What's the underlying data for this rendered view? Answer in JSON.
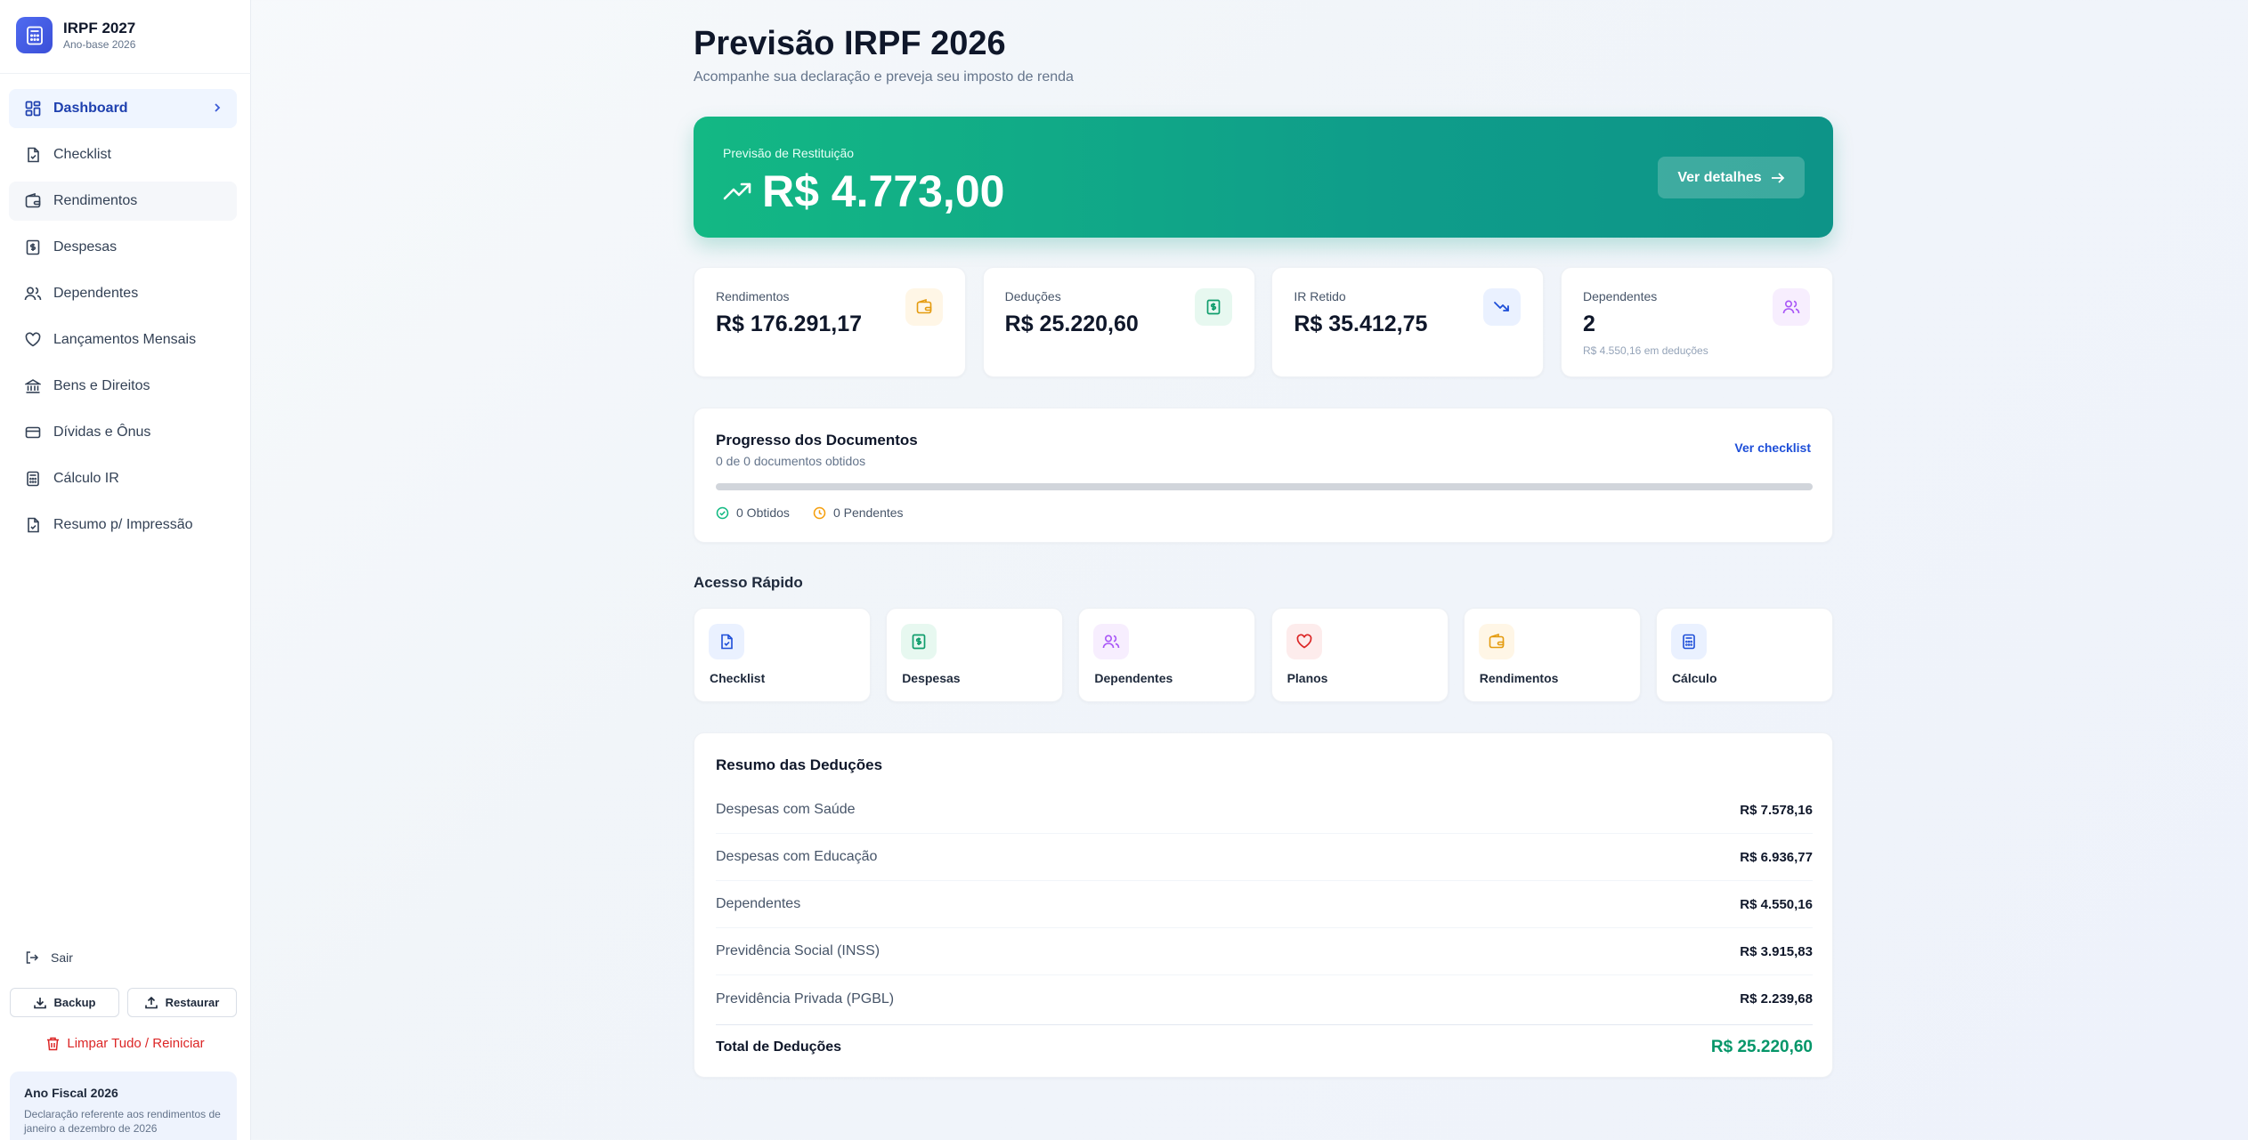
{
  "brand": {
    "title": "IRPF 2027",
    "subtitle": "Ano-base 2026"
  },
  "sidebar": {
    "items": [
      {
        "label": "Dashboard",
        "icon": "dashboard-grid-icon",
        "active": true
      },
      {
        "label": "Checklist",
        "icon": "file-check-icon"
      },
      {
        "label": "Rendimentos",
        "icon": "wallet-icon"
      },
      {
        "label": "Despesas",
        "icon": "receipt-icon"
      },
      {
        "label": "Dependentes",
        "icon": "users-icon"
      },
      {
        "label": "Lançamentos Mensais",
        "icon": "heart-icon"
      },
      {
        "label": "Bens e Direitos",
        "icon": "bank-icon"
      },
      {
        "label": "Dívidas e Ônus",
        "icon": "credit-card-icon"
      },
      {
        "label": "Cálculo IR",
        "icon": "calculator-icon"
      },
      {
        "label": "Resumo p/ Impressão",
        "icon": "file-check-icon"
      }
    ],
    "logout": "Sair",
    "backup": "Backup",
    "restore": "Restaurar",
    "reset": "Limpar Tudo / Reiniciar",
    "fiscal_title": "Ano Fiscal 2026",
    "fiscal_desc": "Declaração referente aos rendimentos de janeiro a dezembro de 2026"
  },
  "header": {
    "title": "Previsão IRPF 2026",
    "subtitle": "Acompanhe sua declaração e preveja seu imposto de renda"
  },
  "hero": {
    "label": "Previsão de Restituição",
    "value": "R$ 4.773,00",
    "button": "Ver detalhes"
  },
  "stats": [
    {
      "label": "Rendimentos",
      "value": "R$ 176.291,17",
      "note": ""
    },
    {
      "label": "Deduções",
      "value": "R$ 25.220,60",
      "note": ""
    },
    {
      "label": "IR Retido",
      "value": "R$ 35.412,75",
      "note": ""
    },
    {
      "label": "Dependentes",
      "value": "2",
      "note": "R$ 4.550,16 em deduções"
    }
  ],
  "progress": {
    "title": "Progresso dos Documentos",
    "subtitle": "0 de 0 documentos obtidos",
    "link": "Ver checklist",
    "percent": 0,
    "obtained": "0 Obtidos",
    "pending": "0 Pendentes"
  },
  "quick_access": {
    "title": "Acesso Rápido",
    "items": [
      {
        "label": "Checklist"
      },
      {
        "label": "Despesas"
      },
      {
        "label": "Dependentes"
      },
      {
        "label": "Planos"
      },
      {
        "label": "Rendimentos"
      },
      {
        "label": "Cálculo"
      }
    ]
  },
  "deductions": {
    "title": "Resumo das Deduções",
    "rows": [
      {
        "label": "Despesas com Saúde",
        "value": "R$ 7.578,16"
      },
      {
        "label": "Despesas com Educação",
        "value": "R$ 6.936,77"
      },
      {
        "label": "Dependentes",
        "value": "R$ 4.550,16"
      },
      {
        "label": "Previdência Social (INSS)",
        "value": "R$ 3.915,83"
      },
      {
        "label": "Previdência Privada (PGBL)",
        "value": "R$ 2.239,68"
      }
    ],
    "total_label": "Total de Deduções",
    "total_value": "R$ 25.220,60"
  },
  "colors": {
    "accent": "#1e40af",
    "hero_start": "#13b884",
    "hero_end": "#0d9488",
    "danger": "#dc2626",
    "success": "#059669"
  }
}
